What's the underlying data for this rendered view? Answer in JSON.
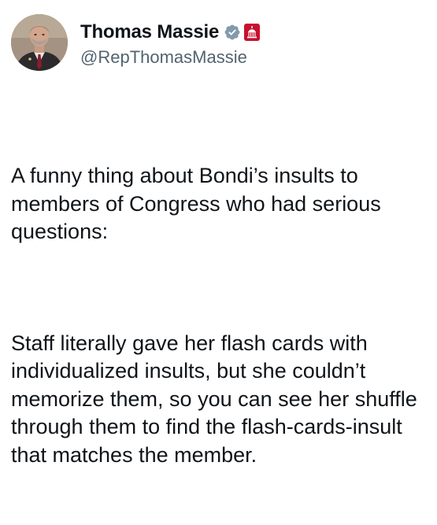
{
  "author": {
    "display_name": "Thomas Massie",
    "handle": "@RepThomasMassie",
    "verified_icon": "verified-check-icon",
    "affiliation_icon": "us-capitol-badge-icon",
    "colors": {
      "verified": "#829aab",
      "affiliation": "#c8102e",
      "handle": "#536471"
    }
  },
  "tweet": {
    "paragraphs": [
      "A funny thing about Bondi’s insults to members of Congress who had serious questions:",
      "Staff literally gave her flash cards with individualized insults, but she couldn’t memorize them, so you can see her shuffle through them to find the flash-cards-insult that matches the member."
    ]
  }
}
